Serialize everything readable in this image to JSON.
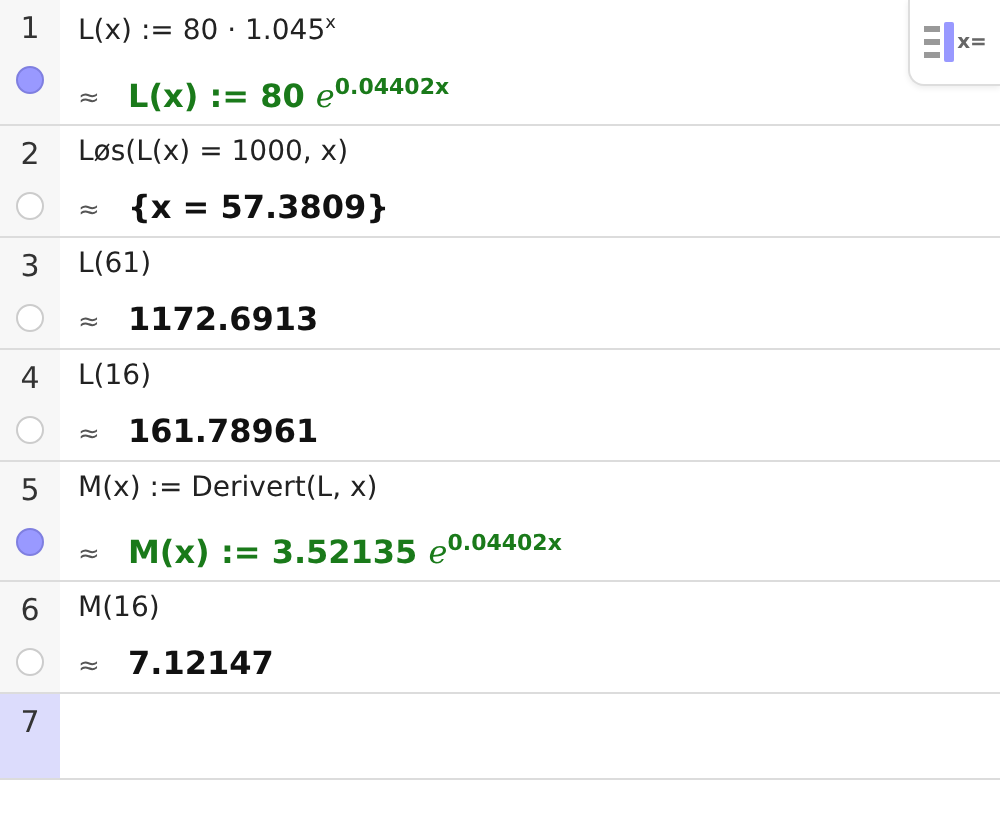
{
  "rows": [
    {
      "number": "1",
      "input": "L(x) := 80 · 1.045$^{x}$",
      "approx": "≈",
      "output": "L(x) := 80 *e*$^{0.04402x}$",
      "kind": "definition",
      "visible": true,
      "selected": false
    },
    {
      "number": "2",
      "input": "Løs(L(x) = 1000, x)",
      "approx": "≈",
      "output": "{x = 57.3809}",
      "kind": "value",
      "visible": false,
      "selected": false
    },
    {
      "number": "3",
      "input": "L(61)",
      "approx": "≈",
      "output": "1172.6913",
      "kind": "value",
      "visible": false,
      "selected": false
    },
    {
      "number": "4",
      "input": "L(16)",
      "approx": "≈",
      "output": "161.78961",
      "kind": "value",
      "visible": false,
      "selected": false
    },
    {
      "number": "5",
      "input": "M(x) := Derivert(L, x)",
      "approx": "≈",
      "output": "M(x) := 3.52135 *e*$^{0.04402x}$",
      "kind": "definition",
      "visible": true,
      "selected": false
    },
    {
      "number": "6",
      "input": "M(16)",
      "approx": "≈",
      "output": "7.12147",
      "kind": "value",
      "visible": false,
      "selected": false
    },
    {
      "number": "7",
      "selected": true
    }
  ],
  "keyboard_toggle": {
    "label": "x="
  }
}
